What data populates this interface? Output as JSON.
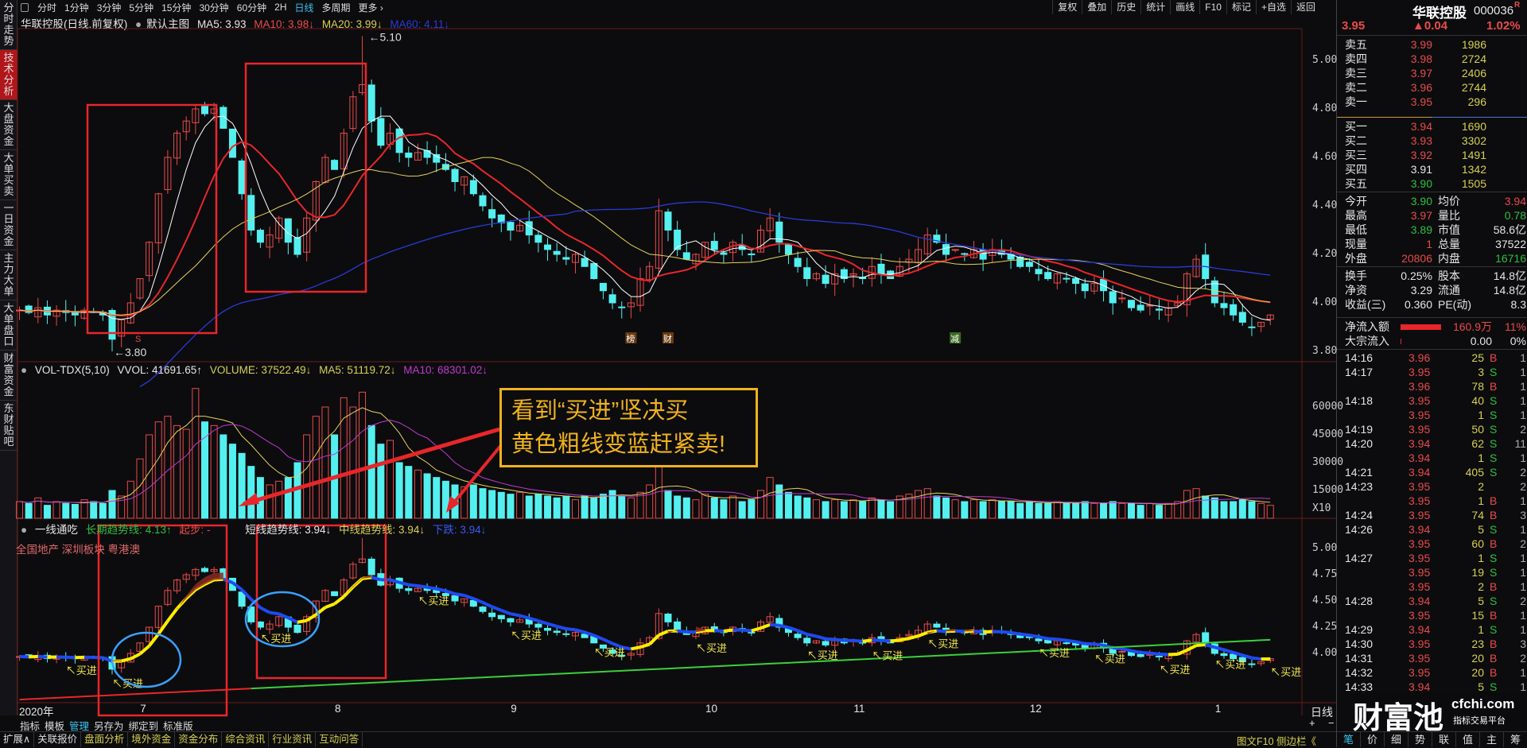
{
  "sidebar": {
    "tabs": [
      "分时走势",
      "技术分析",
      "大盘资金",
      "大单买卖",
      "一日资金",
      "主力大单",
      "大单盘口",
      "财富资金",
      "东财贴吧"
    ],
    "active": 1
  },
  "toolbar": {
    "periods": [
      "分时",
      "1分钟",
      "3分钟",
      "5分钟",
      "15分钟",
      "30分钟",
      "60分钟",
      "2H",
      "日线",
      "多周期",
      "更多 ›"
    ],
    "active": "日线",
    "right_tools": [
      "复权",
      "叠加",
      "历史",
      "统计",
      "画线",
      "F10",
      "标记",
      "+自选",
      "返回"
    ]
  },
  "price_header": {
    "title": "华联控股(日线.前复权)",
    "template": "默认主图",
    "ma5": "MA5: 3.93",
    "ma10": "MA10: 3.98↓",
    "ma20": "MA20: 3.99↓",
    "ma60": "MA60: 4.11↓"
  },
  "price_axis": [
    "5.00",
    "4.80",
    "4.60",
    "4.40",
    "4.20",
    "4.00",
    "3.80"
  ],
  "price_annotations": {
    "high": "5.10",
    "low": "3.80",
    "markers": [
      "S",
      "榜",
      "财",
      "减"
    ]
  },
  "vol_header": {
    "name": "VOL-TDX(5,10)",
    "vvol": "VVOL: 41691.65↑",
    "volume": "VOLUME: 37522.49↓",
    "ma5": "MA5: 51119.72↓",
    "ma10": "MA10: 68301.02↓"
  },
  "vol_axis": [
    "60000",
    "45000",
    "30000",
    "15000",
    "X10"
  ],
  "ind_header": {
    "name": "一线通吃",
    "long": "长期趋势线: 4.13↑",
    "start": "起步: -",
    "short": "短线趋势线: 3.94↓",
    "mid": "中线趋势线: 3.94↓",
    "down": "下跌: 3.94↓"
  },
  "ind_sectors": "全国地产 深圳板块 粤港澳",
  "ind_axis": [
    "5.00",
    "4.75",
    "4.50",
    "4.25",
    "4.00"
  ],
  "signal_label": "买进",
  "date_axis": {
    "year": "2020年",
    "months": [
      "7",
      "8",
      "9",
      "10",
      "11",
      "12",
      "1"
    ],
    "period": "日线",
    "plus": "+",
    "minus": "−"
  },
  "annotation": {
    "line1": "看到“买进”坚决买",
    "line2": "黄色粗线变蓝赶紧卖!"
  },
  "colors": {
    "up": "#e84a4a",
    "down": "#54f0f0",
    "ma5": "#ffffff",
    "ma10": "#e8262a",
    "ma20": "#e6d25a",
    "ma60": "#2a3ad8",
    "box": "#e8262a",
    "ellipse": "#3aa0ff"
  },
  "chart_data": {
    "type": "candlestick",
    "closes": [
      3.97,
      3.96,
      3.98,
      3.95,
      3.97,
      3.96,
      3.95,
      3.97,
      3.96,
      3.95,
      3.85,
      3.93,
      4.0,
      4.1,
      4.25,
      4.45,
      4.6,
      4.7,
      4.75,
      4.8,
      4.78,
      4.8,
      4.72,
      4.6,
      4.45,
      4.3,
      4.25,
      4.28,
      4.35,
      4.25,
      4.2,
      4.35,
      4.5,
      4.6,
      4.55,
      4.7,
      4.85,
      4.9,
      4.75,
      4.65,
      4.7,
      4.62,
      4.6,
      4.62,
      4.6,
      4.58,
      4.55,
      4.5,
      4.52,
      4.45,
      4.4,
      4.35,
      4.33,
      4.3,
      4.32,
      4.28,
      4.25,
      4.22,
      4.2,
      4.18,
      4.2,
      4.15,
      4.1,
      4.05,
      4.0,
      3.98,
      4.0,
      4.1,
      4.15,
      4.38,
      4.3,
      4.22,
      4.18,
      4.2,
      4.25,
      4.22,
      4.2,
      4.25,
      4.22,
      4.2,
      4.3,
      4.35,
      4.25,
      4.2,
      4.15,
      4.1,
      4.12,
      4.08,
      4.12,
      4.1,
      4.12,
      4.1,
      4.15,
      4.12,
      4.1,
      4.15,
      4.18,
      4.22,
      4.28,
      4.25,
      4.2,
      4.22,
      4.2,
      4.22,
      4.18,
      4.22,
      4.2,
      4.18,
      4.15,
      4.15,
      4.12,
      4.1,
      4.12,
      4.1,
      4.08,
      4.05,
      4.08,
      4.05,
      4.0,
      4.02,
      3.98,
      3.97,
      3.99,
      3.97,
      3.98,
      4.0,
      4.12,
      4.18,
      4.1,
      4.0,
      3.98,
      3.95,
      3.92,
      3.9,
      3.92,
      3.95
    ],
    "volumes": [
      9000,
      8000,
      11000,
      7000,
      9000,
      8000,
      7500,
      10000,
      9000,
      8000,
      15000,
      12000,
      20000,
      32000,
      45000,
      52000,
      55000,
      50000,
      48000,
      70000,
      52000,
      50000,
      45000,
      40000,
      35000,
      28000,
      22000,
      18000,
      20000,
      22000,
      30000,
      45000,
      55000,
      60000,
      45000,
      65000,
      60000,
      68000,
      50000,
      40000,
      42000,
      30000,
      28000,
      26000,
      24000,
      22000,
      20000,
      18000,
      17000,
      18000,
      16000,
      15000,
      14000,
      13000,
      14000,
      12000,
      13000,
      12000,
      11000,
      12000,
      10000,
      12000,
      11000,
      13000,
      15000,
      12000,
      11000,
      14000,
      18000,
      28000,
      15000,
      12000,
      11000,
      10000,
      13000,
      11000,
      10000,
      12000,
      9000,
      10000,
      15000,
      22000,
      18000,
      14000,
      12000,
      11000,
      10000,
      9000,
      10000,
      9000,
      10000,
      9000,
      11000,
      10000,
      9000,
      12000,
      13000,
      15000,
      16000,
      12000,
      11000,
      10000,
      9000,
      10000,
      9000,
      10000,
      9000,
      9000,
      8000,
      9000,
      8000,
      8000,
      9000,
      8000,
      8000,
      9000,
      8000,
      8000,
      9000,
      8000,
      8000,
      7000,
      8000,
      7000,
      8000,
      9000,
      15000,
      16000,
      12000,
      11000,
      9000,
      9000,
      10000,
      9000,
      8000,
      7000
    ],
    "signal_indices": [
      5,
      10,
      26,
      43,
      53,
      62,
      73,
      85,
      92,
      98,
      110,
      116,
      123,
      129,
      135
    ],
    "price_ylim": [
      3.78,
      5.12
    ],
    "ind_ylim": [
      3.75,
      5.2
    ]
  },
  "quote": {
    "name": "华联控股",
    "code": "000036",
    "badge": "R",
    "price": "3.95",
    "change": "▲0.04",
    "pct": "1.02%",
    "asks": [
      {
        "label": "卖五",
        "price": "3.99",
        "vol": "1986"
      },
      {
        "label": "卖四",
        "price": "3.98",
        "vol": "2724"
      },
      {
        "label": "卖三",
        "price": "3.97",
        "vol": "2406"
      },
      {
        "label": "卖二",
        "price": "3.96",
        "vol": "2744"
      },
      {
        "label": "卖一",
        "price": "3.95",
        "vol": "296"
      }
    ],
    "bids": [
      {
        "label": "买一",
        "price": "3.94",
        "vol": "1690",
        "c": "red"
      },
      {
        "label": "买二",
        "price": "3.93",
        "vol": "3302",
        "c": "red"
      },
      {
        "label": "买三",
        "price": "3.92",
        "vol": "1491",
        "c": "red"
      },
      {
        "label": "买四",
        "price": "3.91",
        "vol": "1342",
        "c": "wht"
      },
      {
        "label": "买五",
        "price": "3.90",
        "vol": "1505",
        "c": "grn"
      }
    ],
    "stats1": [
      {
        "l": "今开",
        "v": "3.90",
        "c": "grn",
        "l2": "均价",
        "v2": "3.94",
        "c2": "red"
      },
      {
        "l": "最高",
        "v": "3.97",
        "c": "red",
        "l2": "量比",
        "v2": "0.78",
        "c2": "grn"
      },
      {
        "l": "最低",
        "v": "3.89",
        "c": "grn",
        "l2": "市值",
        "v2": "58.6亿",
        "c2": "wht"
      },
      {
        "l": "现量",
        "v": "1",
        "c": "red",
        "l2": "总量",
        "v2": "37522",
        "c2": "wht"
      },
      {
        "l": "外盘",
        "v": "20806",
        "c": "red",
        "l2": "内盘",
        "v2": "16716",
        "c2": "grn"
      }
    ],
    "stats2": [
      {
        "l": "换手",
        "v": "0.25%",
        "l2": "股本",
        "v2": "14.8亿"
      },
      {
        "l": "净资",
        "v": "3.29",
        "l2": "流通",
        "v2": "14.8亿"
      },
      {
        "l": "收益(三)",
        "v": "0.360",
        "l2": "PE(动)",
        "v2": "8.3"
      }
    ],
    "flow": [
      {
        "l": "净流入额",
        "v": "160.9万",
        "p": "11%",
        "bar": 0.6
      },
      {
        "l": "大宗流入",
        "v": "0.00",
        "p": "0%",
        "bar": 0
      }
    ]
  },
  "ticks": [
    [
      "14:16",
      "3.96",
      "25",
      "B",
      "1"
    ],
    [
      "14:17",
      "3.95",
      "3",
      "S",
      "1"
    ],
    [
      "",
      "3.96",
      "78",
      "B",
      "1"
    ],
    [
      "14:18",
      "3.95",
      "40",
      "S",
      "1"
    ],
    [
      "",
      "3.95",
      "1",
      "S",
      "1"
    ],
    [
      "14:19",
      "3.95",
      "50",
      "S",
      "2"
    ],
    [
      "14:20",
      "3.94",
      "62",
      "S",
      "11"
    ],
    [
      "",
      "3.94",
      "1",
      "S",
      "1"
    ],
    [
      "14:21",
      "3.94",
      "405",
      "S",
      "2"
    ],
    [
      "14:23",
      "3.95",
      "2",
      "",
      "2"
    ],
    [
      "",
      "3.95",
      "1",
      "B",
      "1"
    ],
    [
      "14:24",
      "3.95",
      "74",
      "B",
      "3"
    ],
    [
      "14:26",
      "3.94",
      "5",
      "S",
      "1"
    ],
    [
      "",
      "3.95",
      "60",
      "B",
      "2"
    ],
    [
      "14:27",
      "3.95",
      "1",
      "S",
      "1"
    ],
    [
      "",
      "3.95",
      "19",
      "S",
      "1"
    ],
    [
      "",
      "3.95",
      "2",
      "B",
      "1"
    ],
    [
      "14:28",
      "3.94",
      "5",
      "S",
      "2"
    ],
    [
      "",
      "3.95",
      "15",
      "B",
      "1"
    ],
    [
      "14:29",
      "3.94",
      "1",
      "S",
      "1"
    ],
    [
      "14:30",
      "3.95",
      "23",
      "B",
      "3"
    ],
    [
      "14:31",
      "3.95",
      "20",
      "B",
      "2"
    ],
    [
      "14:32",
      "3.95",
      "20",
      "B",
      "1"
    ],
    [
      "14:33",
      "3.94",
      "5",
      "S",
      "1"
    ]
  ],
  "watermark": {
    "brand": "财富池",
    "site": "cfchi.com",
    "slogan": "指标交易平台"
  },
  "bottom_bar1": [
    "指标",
    "模板",
    "管理",
    "另存为",
    "绑定到",
    "标准版"
  ],
  "bottom_bar2": [
    "扩展∧",
    "关联报价",
    "盘面分析",
    "境外资金",
    "资金分布",
    "综合资讯",
    "行业资讯",
    "互动问答"
  ],
  "bottom_right": "图文F10 侧边栏《",
  "right_tabs": [
    "笔",
    "价",
    "细",
    "势",
    "联",
    "值",
    "主",
    "筹"
  ]
}
